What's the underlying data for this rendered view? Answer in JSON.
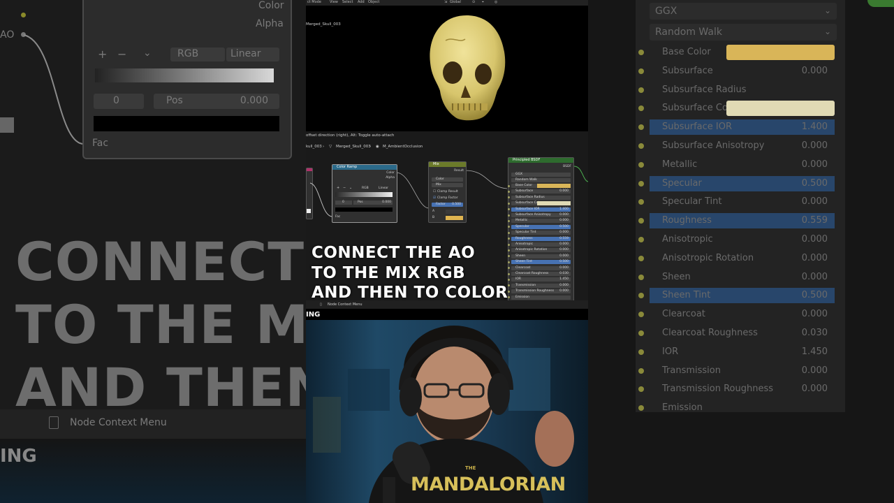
{
  "bg_left": {
    "output_color": "Color",
    "output_alpha": "Alpha",
    "input_ao": "AO",
    "input_fac": "Fac",
    "mode": "RGB",
    "interp": "Linear",
    "pos_index": "0",
    "pos_label": "Pos",
    "pos_value": "0.000",
    "caption_lines": [
      "CONNECT T",
      "TO THE MIX",
      "AND THEN"
    ],
    "context_menu": "Node Context Menu",
    "bottom_text": "ING"
  },
  "bg_right": {
    "dropdown1": "GGX",
    "dropdown2": "Random Walk",
    "rows": [
      {
        "label": "Base Color",
        "value": "",
        "swatch": "#d9b558"
      },
      {
        "label": "Subsurface",
        "value": "0.000"
      },
      {
        "label": "Subsurface Radius",
        "value": ""
      },
      {
        "label": "Subsurface Color",
        "value": "",
        "swatch": "#e0dab4"
      },
      {
        "label": "Subsurface IOR",
        "value": "1.400"
      },
      {
        "label": "Subsurface Anisotropy",
        "value": "0.000"
      },
      {
        "label": "Metallic",
        "value": "0.000"
      },
      {
        "label": "Specular",
        "value": "0.500"
      },
      {
        "label": "Specular Tint",
        "value": "0.000"
      },
      {
        "label": "Roughness",
        "value": "0.559"
      },
      {
        "label": "Anisotropic",
        "value": "0.000"
      },
      {
        "label": "Anisotropic Rotation",
        "value": "0.000"
      },
      {
        "label": "Sheen",
        "value": "0.000"
      },
      {
        "label": "Sheen Tint",
        "value": "0.500"
      },
      {
        "label": "Clearcoat",
        "value": "0.000"
      },
      {
        "label": "Clearcoat Roughness",
        "value": "0.030"
      },
      {
        "label": "IOR",
        "value": "1.450"
      },
      {
        "label": "Transmission",
        "value": "0.000"
      },
      {
        "label": "Transmission Roughness",
        "value": "0.000"
      },
      {
        "label": "Emission",
        "value": ""
      }
    ]
  },
  "center": {
    "menu": [
      "ct Mode",
      "View",
      "Select",
      "Add",
      "Object"
    ],
    "global": "Global",
    "object_name": "Merged_Skull_003",
    "status_hint": "offset direction (right), Alt: Toggle auto-attach",
    "breadcrumb": [
      "kull_003",
      "Merged_Skull_003",
      "M_AmbientOcclusion"
    ],
    "color_ramp": {
      "title": "Color Ramp",
      "out_color": "Color",
      "out_alpha": "Alpha",
      "mode": "RGB",
      "interp": "Linear",
      "pos_index": "0",
      "pos_label": "Pos",
      "pos_value": "0.000",
      "fac": "Fac"
    },
    "mix": {
      "title": "Mix",
      "out_result": "Result",
      "type": "Color",
      "blend": "Mix",
      "clamp_result": "Clamp Result",
      "clamp_factor": "Clamp Factor",
      "factor_label": "Factor",
      "factor_value": "0.500",
      "a": "A",
      "b": "B"
    },
    "bsdf": {
      "title": "Principled BSDF",
      "out": "BSDF",
      "dist": "GGX",
      "sss": "Random Walk",
      "rows": [
        {
          "label": "Base Color",
          "value": ""
        },
        {
          "label": "Subsurface",
          "value": "0.000"
        },
        {
          "label": "Subsurface Radius",
          "value": ""
        },
        {
          "label": "Subsurface Color",
          "value": ""
        },
        {
          "label": "Subsurface IOR",
          "value": "1.400"
        },
        {
          "label": "Subsurface Anisotropy",
          "value": "0.000"
        },
        {
          "label": "Metallic",
          "value": "0.000"
        },
        {
          "label": "Specular",
          "value": "0.500"
        },
        {
          "label": "Specular Tint",
          "value": "0.000"
        },
        {
          "label": "Roughness",
          "value": "0.559"
        },
        {
          "label": "Anisotropic",
          "value": "0.000"
        },
        {
          "label": "Anisotropic Rotation",
          "value": "0.000"
        },
        {
          "label": "Sheen",
          "value": "0.000"
        },
        {
          "label": "Sheen Tint",
          "value": "0.500"
        },
        {
          "label": "Clearcoat",
          "value": "0.000"
        },
        {
          "label": "Clearcoat Roughness",
          "value": "0.030"
        },
        {
          "label": "IOR",
          "value": "1.450"
        },
        {
          "label": "Transmission",
          "value": "0.000"
        },
        {
          "label": "Transmission Roughness",
          "value": "0.000"
        },
        {
          "label": "Emission",
          "value": ""
        }
      ]
    },
    "context_menu": "Node Context Menu",
    "caption_lines": [
      "CONNECT THE AO",
      "TO THE MIX RGB",
      "AND THEN TO COLOR"
    ],
    "strip_text": "ING",
    "shirt_small": "THE",
    "shirt_text": "MANDALORIAN"
  },
  "colors": {
    "base_color": "#d9b558",
    "subsurface_color": "#e0dab4",
    "highlight_blue": "#4772b3",
    "color_ramp_header": "#2b6a8a",
    "mix_header": "#6b7a2a",
    "bsdf_header": "#2e6b2e"
  }
}
